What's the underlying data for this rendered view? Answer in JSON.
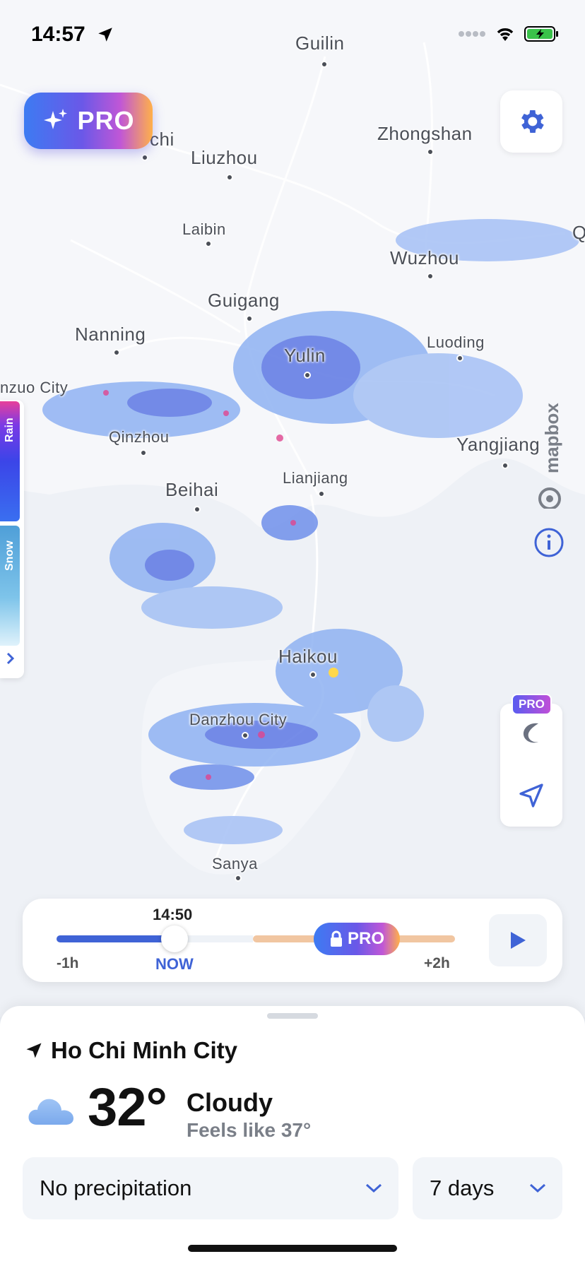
{
  "status_bar": {
    "time": "14:57"
  },
  "header": {
    "pro_label": "PRO"
  },
  "map": {
    "cities": [
      {
        "name": "Guilin"
      },
      {
        "name": "Zhongshan"
      },
      {
        "name": "chi"
      },
      {
        "name": "Liuzhou"
      },
      {
        "name": "Laibin"
      },
      {
        "name": "Wuzhou"
      },
      {
        "name": "Q"
      },
      {
        "name": "Guigang"
      },
      {
        "name": "Nanning"
      },
      {
        "name": "Yulin"
      },
      {
        "name": "Luoding"
      },
      {
        "name": "nzuo City"
      },
      {
        "name": "Qinzhou"
      },
      {
        "name": "Yangjiang"
      },
      {
        "name": "Beihai"
      },
      {
        "name": "Lianjiang"
      },
      {
        "name": "Haikou"
      },
      {
        "name": "Danzhou City"
      },
      {
        "name": "Sanya"
      }
    ],
    "attribution": "mapbox"
  },
  "legend": {
    "rain_label": "Rain",
    "snow_label": "Snow"
  },
  "tools": {
    "badge": "PRO"
  },
  "timeline": {
    "current_time": "14:50",
    "progress_fraction": 0.37,
    "pro_label": "PRO",
    "labels": {
      "start": "-1h",
      "now": "NOW",
      "end": "+2h"
    }
  },
  "weather": {
    "location": "Ho Chi Minh City",
    "temperature": "32°",
    "condition": "Cloudy",
    "feels_like": "Feels like 37°",
    "precip_select": "No precipitation",
    "days_select": "7 days"
  },
  "colors": {
    "accent": "#3f63d6",
    "rain_strong": "#3b45e8",
    "rain_light": "#8fb2f2"
  }
}
